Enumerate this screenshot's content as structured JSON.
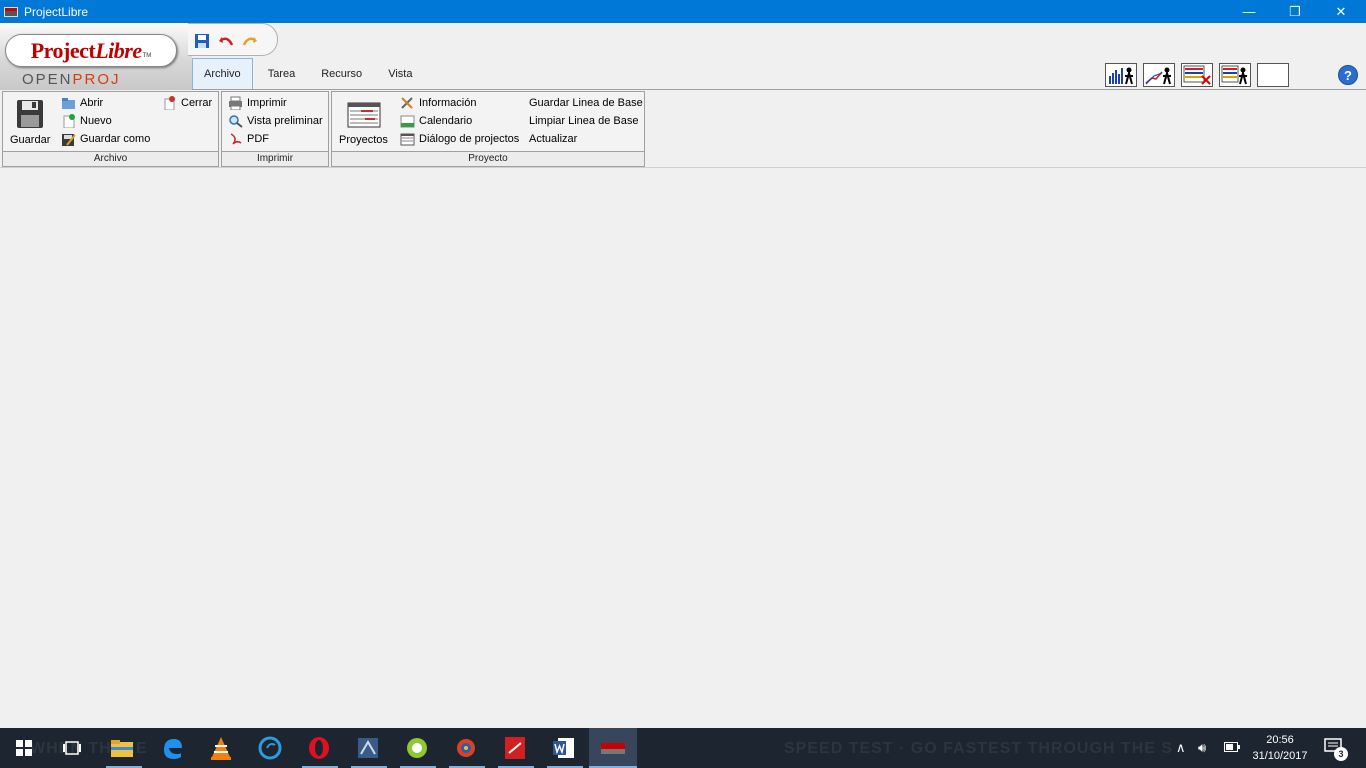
{
  "window": {
    "title": "ProjectLibre",
    "min_glyph": "—",
    "restore_glyph": "❐",
    "close_glyph": "✕"
  },
  "logo": {
    "project": "Project",
    "libre": "Libre",
    "tm": "TM",
    "open": "OPEN",
    "proj": "PROJ"
  },
  "tabs": [
    "Archivo",
    "Tarea",
    "Recurso",
    "Vista"
  ],
  "help": "?",
  "ribbon": {
    "archivo": {
      "label": "Archivo",
      "save": "Guardar",
      "open": "Abrir",
      "new": "Nuevo",
      "save_as": "Guardar como",
      "close": "Cerrar"
    },
    "imprimir": {
      "label": "Imprimir",
      "print": "Imprimir",
      "preview": "Vista preliminar",
      "pdf": "PDF"
    },
    "proyecto": {
      "label": "Proyecto",
      "projects": "Proyectos",
      "info": "Información",
      "calendar": "Calendario",
      "dialog": "Diálogo de projectos",
      "save_baseline": "Guardar Linea de Base",
      "clear_baseline": "Limpiar Linea de Base",
      "update": "Actualizar"
    }
  },
  "taskbar": {
    "time": "20:56",
    "date": "31/10/2017",
    "notifications": "3",
    "bg_text_left": "WHEN THREE",
    "bg_text_right": "SPEED TEST · GO FASTEST THROUGH THE S"
  }
}
